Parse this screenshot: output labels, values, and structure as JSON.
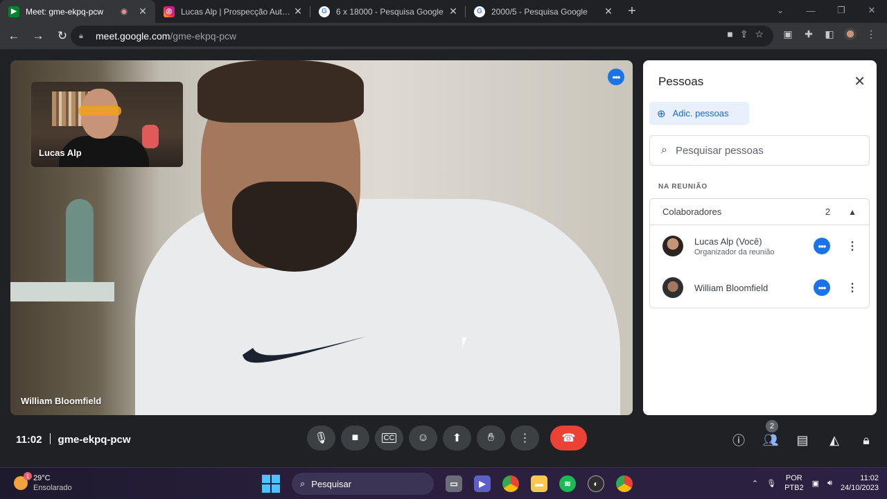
{
  "browser": {
    "tabs": [
      {
        "title": "Meet: gme-ekpq-pcw",
        "favicon": "meet-icon",
        "recording": true,
        "active": true
      },
      {
        "title": "Lucas Alp | Prospecção Automát",
        "favicon": "instagram-icon",
        "active": false
      },
      {
        "title": "6 x 18000 - Pesquisa Google",
        "favicon": "google-icon",
        "active": false
      },
      {
        "title": "2000/5 - Pesquisa Google",
        "favicon": "google-icon",
        "active": false
      }
    ],
    "new_tab": "+",
    "url_host": "meet.google.com",
    "url_path": "/gme-ekpq-pcw"
  },
  "meeting": {
    "main_participant": "William Bloomfield",
    "pip_participant": "Lucas Alp",
    "time": "11:02",
    "code": "gme-ekpq-pcw",
    "people_badge": "2"
  },
  "people_panel": {
    "title": "Pessoas",
    "add_label": "Adic. pessoas",
    "search_placeholder": "Pesquisar pessoas",
    "section_label": "NA REUNIÃO",
    "group_label": "Colaboradores",
    "group_count": "2",
    "participants": [
      {
        "name": "Lucas Alp (Você)",
        "role": "Organizador da reunião"
      },
      {
        "name": "William Bloomfield",
        "role": ""
      }
    ]
  },
  "taskbar": {
    "weather_temp": "29°C",
    "weather_desc": "Ensolarado",
    "weather_badge": "1",
    "search_label": "Pesquisar",
    "lang_1": "POR",
    "lang_2": "PTB2",
    "time": "11:02",
    "date": "24/10/2023"
  },
  "colors": {
    "accent_blue": "#1a73e8",
    "end_call_red": "#ea4335",
    "panel_bg": "#ffffff"
  }
}
